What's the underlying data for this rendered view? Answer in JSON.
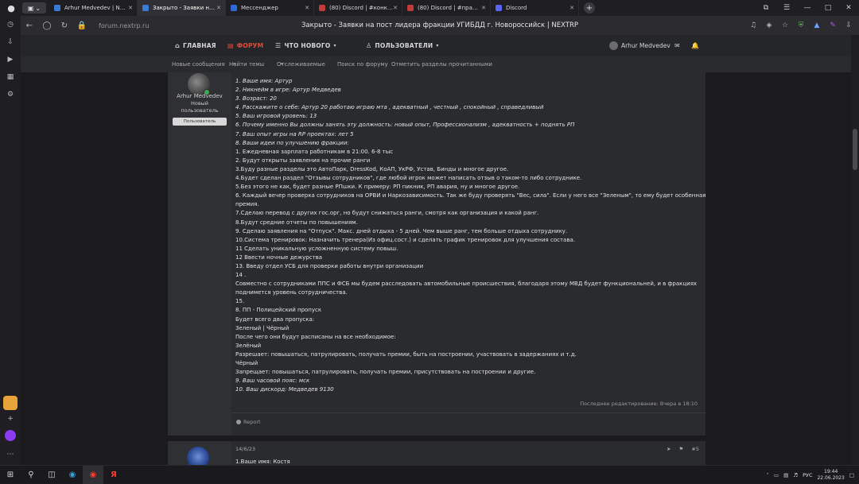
{
  "browser": {
    "tabs": [
      {
        "title": "Arhur Medvedev | NEXTR",
        "color": "#3a7bd5"
      },
      {
        "title": "Закрыто - Заявки на по",
        "color": "#3a7bd5",
        "active": true
      },
      {
        "title": "Мессенджер",
        "color": "#2f6bd8"
      },
      {
        "title": "(80) Discord | #конкурс | N",
        "color": "#c23b3b"
      },
      {
        "title": "(80) Discord | #правила | N",
        "color": "#c23b3b"
      },
      {
        "title": "Discord",
        "color": "#5865f2"
      }
    ],
    "url": "forum.nextrp.ru",
    "page_title": "Закрыто - Заявки на пост лидера фракции УГИБДД г. Новороссийск | NEXTRP"
  },
  "navbar": {
    "home": "ГЛАВНАЯ",
    "forum": "ФОРУМ",
    "whats_new": "ЧТО НОВОГО",
    "users": "ПОЛЬЗОВАТЕЛИ",
    "account_name": "Arhur Medvedev"
  },
  "subnav": {
    "new_messages": "Новые сообщения",
    "find_topics": "Найти темы",
    "watched": "Отслеживаемые",
    "search_forum": "Поиск по форуму",
    "mark_read": "Отметить разделы прочитанными"
  },
  "post1": {
    "author": "Arhur Medvedev",
    "author_title_1": "Новый",
    "author_title_2": "пользователь",
    "role_badge": "Пользователь",
    "lines": [
      "1. Ваше имя: Артур",
      "2. Никнейм в игре: Артур Медведев",
      "3. Возраст: 20",
      "4. Расскажите о себе: Артур 20 работаю играю мта , адекватный , честный , спокойный , справедливый",
      "5. Ваш игровой уровень: 13",
      "6. Почему именно Вы должны занять эту должность: новый опыт, Профессионализм , адекватность + поднять РП",
      "7. Ваш опыт игры на RP проектах: лет 5",
      "8. Ваши идеи по улучшению фракции:",
      "1. Ежедневная зарплата работникам в 21:00. 6-8 тыс",
      "2. Будут открыты заявления на прочие ранги",
      "3.Буду разные разделы это АвтоПарк, DressKod, КоАП, УкРФ, Устав, Бинды и многое другое.",
      "4.Будет сделан раздел \"Отзывы сотрудников\", где любой игрок может написать отзыв о таком-то либо сотруднике.",
      "5.Без этого не как, будет разные РПшки. К примеру: РП пикник, РП авария, ну и многое другое.",
      "6. Каждый вечер проверка сотрудников на ОРВИ и Наркозависимость. Так же буду проверять \"Вес, сила\". Если у него все \"Зеленым\", то ему будет особенная",
      "премия.",
      "7.Сделаю перевод с других гос.орг, но будут снижаться ранги, смотря как организация и какой ранг.",
      "8.Будут средние отчеты по повышениям.",
      "9. Сделаю заявления на \"Отпуск\". Макс. дней отдыха - 5 дней. Чем выше ранг, тем больше отдыха сотруднику.",
      "10.Система тренировок: Назначить тренера(Из офиц.сост.) и сделать график тренировок для улучшения состава.",
      "11 Сделать уникальную усложненную систему повыш.",
      "12 Ввести ночные дежурства",
      "13. Введу отдел УСБ для проверки работы внутри организации",
      "14 .",
      "Совместно с сотрудниками ППС и ФСБ мы будем расследовать автомобильные происшествия, благодаря этому МВД будет функциональней, и в фракциях",
      "поднимется уровень сотрудничества.",
      "15.",
      "8. ПП - Полицейский пропуск",
      "Будет всего два пропуска:",
      "Зеленый | Чёрный",
      "После чего они будут расписаны на все необходимое:",
      "Зелёный",
      "Разрешает: повышаться, патрулировать, получать премии, быть на построении, участвовать в задержаниях и т.д.",
      "Чёрный",
      "Запрещает: повышаться, патрулировать, получать премии, присутствовать на построении и другие.",
      "9. Ваш часовой пояс: мск",
      "10. Ваш дискорд: Медведев 9130"
    ],
    "edited": "Последнее редактирование: Вчера в 18:10",
    "report": "Report"
  },
  "post2": {
    "date": "14/6/23",
    "number": "#5",
    "first_line": "1.Ваше имя: Костя"
  },
  "taskbar": {
    "lang": "РУС",
    "time": "19:44",
    "date": "22.06.2023"
  }
}
